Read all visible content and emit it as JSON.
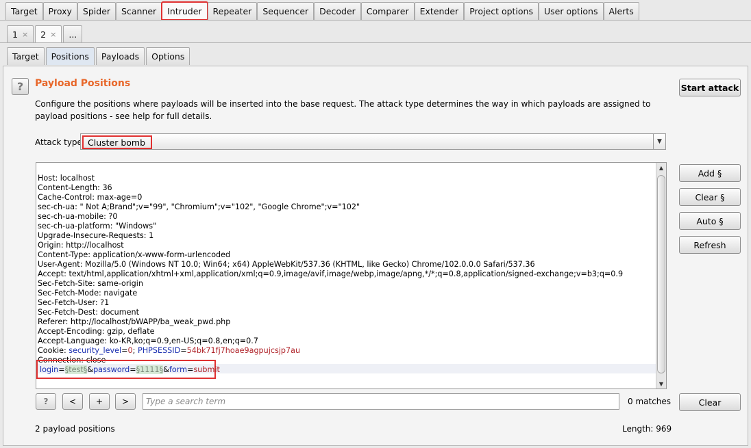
{
  "main_tabs": [
    {
      "label": "Target"
    },
    {
      "label": "Proxy"
    },
    {
      "label": "Spider"
    },
    {
      "label": "Scanner"
    },
    {
      "label": "Intruder"
    },
    {
      "label": "Repeater"
    },
    {
      "label": "Sequencer"
    },
    {
      "label": "Decoder"
    },
    {
      "label": "Comparer"
    },
    {
      "label": "Extender"
    },
    {
      "label": "Project options"
    },
    {
      "label": "User options"
    },
    {
      "label": "Alerts"
    }
  ],
  "attack_tabs": [
    {
      "label": "1",
      "close": "×"
    },
    {
      "label": "2",
      "close": "×"
    },
    {
      "label": "..."
    }
  ],
  "sub_tabs": [
    {
      "label": "Target"
    },
    {
      "label": "Positions"
    },
    {
      "label": "Payloads"
    },
    {
      "label": "Options"
    }
  ],
  "section": {
    "title": "Payload Positions",
    "help_icon": "?",
    "description": "Configure the positions where payloads will be inserted into the base request. The attack type determines the way in which payloads are assigned to payload positions - see help for full details."
  },
  "attack_type": {
    "label": "Attack type:",
    "value": "Cluster bomb"
  },
  "buttons": {
    "start_attack": "Start attack",
    "add": "Add §",
    "clear": "Clear §",
    "auto": "Auto §",
    "refresh": "Refresh",
    "search_clear": "Clear"
  },
  "request": {
    "headers": [
      "Host: localhost",
      "Content-Length: 36",
      "Cache-Control: max-age=0",
      "sec-ch-ua: \" Not A;Brand\";v=\"99\", \"Chromium\";v=\"102\", \"Google Chrome\";v=\"102\"",
      "sec-ch-ua-mobile: ?0",
      "sec-ch-ua-platform: \"Windows\"",
      "Upgrade-Insecure-Requests: 1",
      "Origin: http://localhost",
      "Content-Type: application/x-www-form-urlencoded",
      "User-Agent: Mozilla/5.0 (Windows NT 10.0; Win64; x64) AppleWebKit/537.36 (KHTML, like Gecko) Chrome/102.0.0.0 Safari/537.36",
      "Accept: text/html,application/xhtml+xml,application/xml;q=0.9,image/avif,image/webp,image/apng,*/*;q=0.8,application/signed-exchange;v=b3;q=0.9",
      "Sec-Fetch-Site: same-origin",
      "Sec-Fetch-Mode: navigate",
      "Sec-Fetch-User: ?1",
      "Sec-Fetch-Dest: document",
      "Referer: http://localhost/bWAPP/ba_weak_pwd.php",
      "Accept-Encoding: gzip, deflate",
      "Accept-Language: ko-KR,ko;q=0.9,en-US;q=0.8,en;q=0.7"
    ],
    "cookie": {
      "prefix": "Cookie: ",
      "k1": "security_level",
      "eq1": "=",
      "v1": "0",
      "sep": "; ",
      "k2": "PHPSESSID",
      "eq2": "=",
      "v2": "54bk71fj7hoae9agpujcsjp7au"
    },
    "connection": "Connection: close",
    "body": {
      "k1": "login",
      "eq1": "=",
      "p1": "§test§",
      "amp1": "&",
      "k2": "password",
      "eq2": "=",
      "p2": "§1111§",
      "amp2": "&",
      "k3": "form",
      "eq3": "=",
      "v3": "submit"
    }
  },
  "search": {
    "help": "?",
    "prev": "<",
    "add": "+",
    "next": ">",
    "placeholder": "Type a search term",
    "matches": "0 matches"
  },
  "status": {
    "positions": "2 payload positions",
    "length": "Length: 969"
  },
  "colors": {
    "title": "#e8672a",
    "highlight": "#e03131",
    "param_key": "#1a2fb0",
    "param_value": "#b0242a"
  }
}
